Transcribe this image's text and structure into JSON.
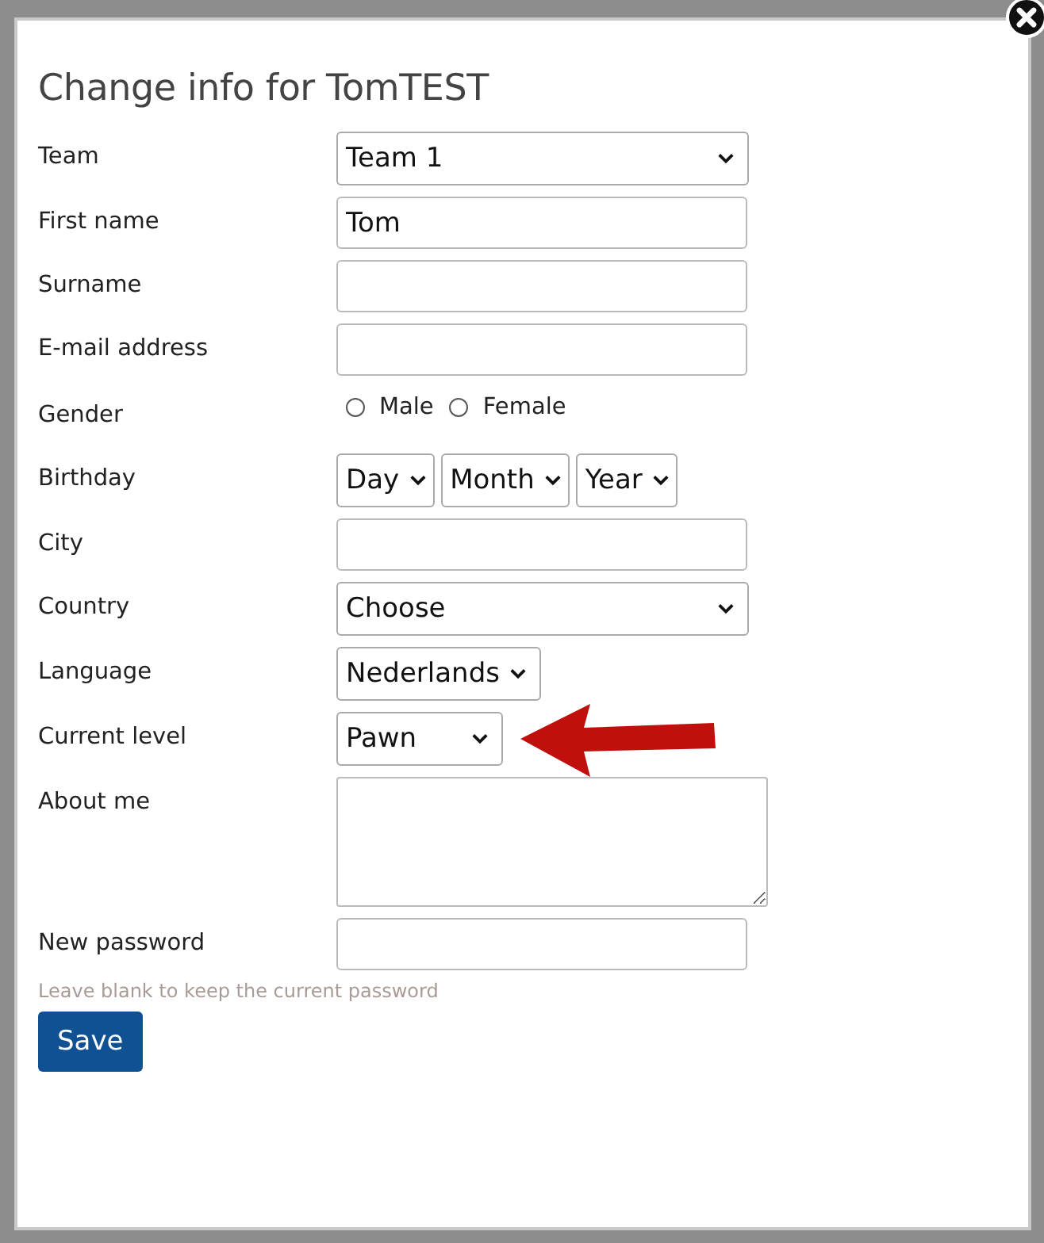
{
  "dialog": {
    "title": "Change info for TomTEST"
  },
  "fields": [
    {
      "kind": "select",
      "label": "Team",
      "value": "Team 1"
    },
    {
      "kind": "text",
      "label": "First name",
      "value": "Tom"
    },
    {
      "kind": "text",
      "label": "Surname"
    },
    {
      "kind": "text",
      "label": "E-mail address"
    },
    {
      "kind": "radio",
      "label": "Gender",
      "options": [
        {
          "label": "Male",
          "selected": false
        },
        {
          "label": "Female",
          "selected": false
        }
      ]
    },
    {
      "kind": "select-group",
      "label": "Birthday",
      "selects": [
        "Day",
        "Month",
        "Year"
      ]
    },
    {
      "kind": "text",
      "label": "City"
    },
    {
      "kind": "select",
      "label": "Country",
      "value": "Choose"
    },
    {
      "kind": "compact-select",
      "label": "Language",
      "value": "Nederlands"
    },
    {
      "kind": "compact-select",
      "label": "Current level",
      "value": "Pawn"
    },
    {
      "kind": "textarea",
      "label": "About me"
    },
    {
      "kind": "password",
      "label": "New password",
      "hint": "Leave blank to keep the current password"
    }
  ],
  "save_button": "Save"
}
